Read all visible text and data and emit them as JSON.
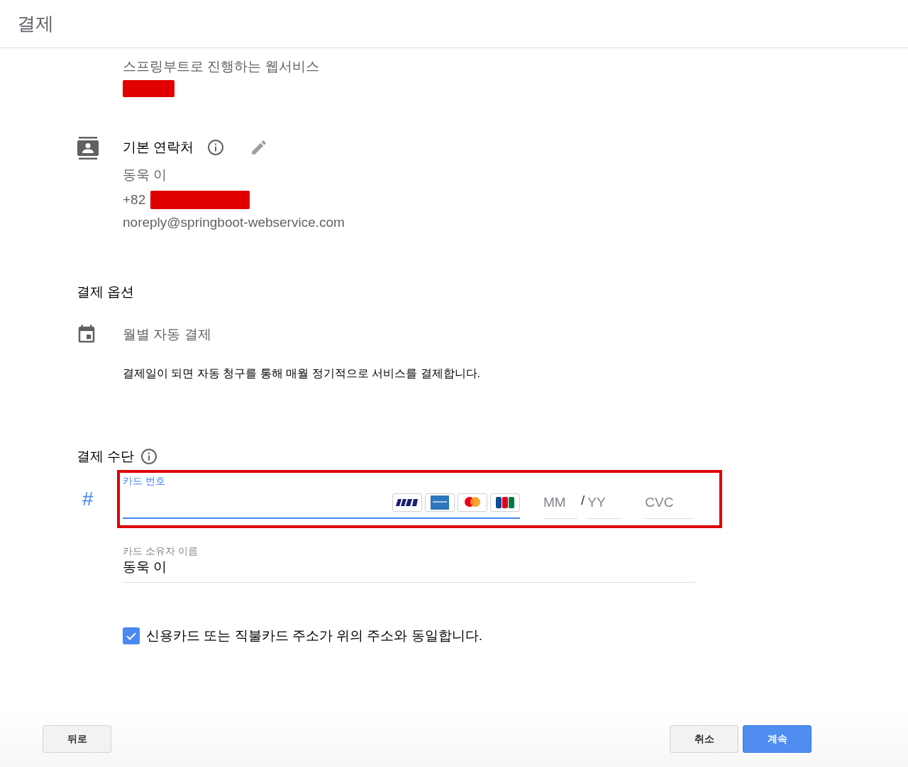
{
  "header": {
    "title": "결제"
  },
  "service": {
    "description": "스프링부트로 진행하는 웹서비스"
  },
  "contact": {
    "title": "기본 연락처",
    "name": "동욱 이",
    "phone_prefix": "+82",
    "email": "noreply@springboot-webservice.com"
  },
  "payment_option": {
    "title": "결제 옵션",
    "plan": "월별 자동 결제",
    "description": "결제일이 되면 자동 청구를 통해 매월 정기적으로 서비스를 결제합니다."
  },
  "payment_method": {
    "title": "결제 수단",
    "icon": "#",
    "card_number": {
      "label": "카드 번호",
      "focused": true
    },
    "expiry_month": {
      "placeholder": "MM"
    },
    "expiry_separator": "/",
    "expiry_year": {
      "placeholder": "YY"
    },
    "cvc": {
      "placeholder": "CVC"
    },
    "cardholder": {
      "label": "카드 소유자 이름",
      "value": "동욱 이"
    },
    "same_address": {
      "label": "신용카드 또는 직불카드 주소가 위의 주소와 동일합니다.",
      "checked": true
    }
  },
  "buttons": [
    {
      "label": "뒤로",
      "kind": "secondary"
    },
    {
      "label": "취소",
      "kind": "secondary"
    },
    {
      "label": "계속",
      "kind": "primary"
    }
  ]
}
